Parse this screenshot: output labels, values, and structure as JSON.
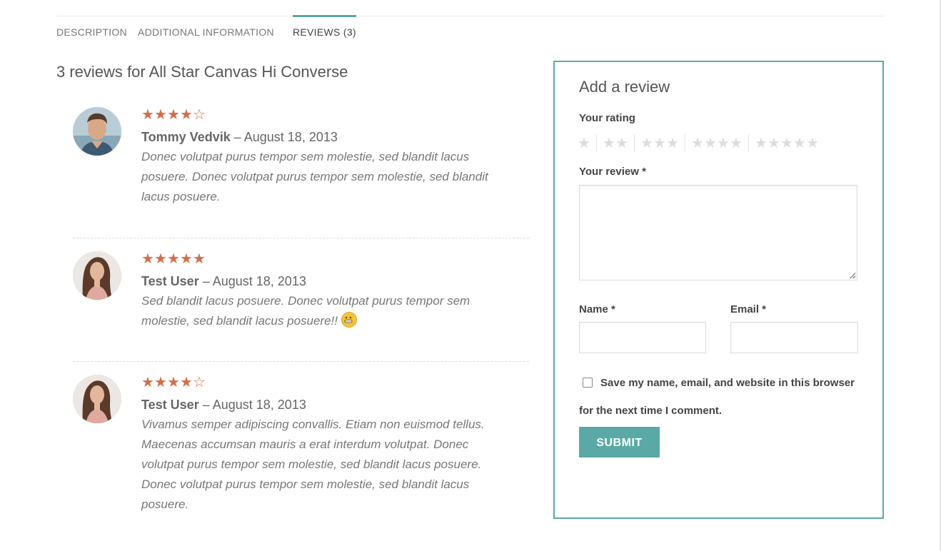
{
  "tabs": [
    {
      "label": "Description"
    },
    {
      "label": "Additional Information"
    },
    {
      "label": "Reviews (3)"
    }
  ],
  "reviews_title": "3 reviews for All Star Canvas Hi Converse",
  "reviews": [
    {
      "rating": 4,
      "author": "Tommy Vedvik",
      "date": "– August 18, 2013",
      "text": "Donec volutpat purus tempor sem molestie, sed blandit lacus posuere. Donec volutpat purus tempor sem molestie, sed blandit lacus posuere."
    },
    {
      "rating": 5,
      "author": "Test User",
      "date": "– August 18, 2013",
      "text": "Sed blandit lacus posuere. Donec volutpat purus tempor sem molestie, sed blandit lacus posuere!!"
    },
    {
      "rating": 4,
      "author": "Test User",
      "date": "– August 18, 2013",
      "text": "Vivamus semper adipiscing convallis. Etiam non euismod tellus. Maecenas accumsan mauris a erat interdum volutpat. Donec volutpat purus tempor sem molestie, sed blandit lacus posuere. Donec volutpat purus tempor sem molestie, sed blandit lacus posuere."
    }
  ],
  "form": {
    "title": "Add a review",
    "rating_label": "Your rating",
    "review_label": "Your review *",
    "name_label": "Name *",
    "email_label": "Email *",
    "consent_label": "Save my name, email, and website in this browser for the next time I comment.",
    "submit_label": "Submit"
  },
  "colors": {
    "accent": "#5aa9a6",
    "star": "#d26e4b"
  }
}
